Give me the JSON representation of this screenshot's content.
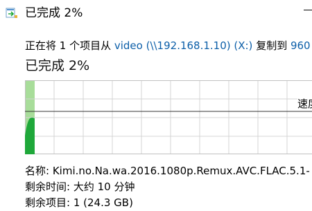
{
  "window": {
    "title": "已完成 2%",
    "minimize_icon": "minimize-icon",
    "app_icon": "copy-progress-icon"
  },
  "operation": {
    "prefix": "正在将 1 个项目从 ",
    "source": "video (\\\\192.168.1.10) (X:)",
    "middle": " 复制到 ",
    "destination": "960"
  },
  "progress": {
    "label": "已完成 2%",
    "percent": 2
  },
  "graph": {
    "speed_label": "速度",
    "colors": {
      "completed_fill": "#a8dd9a",
      "speed_area": "#1fa83a",
      "grid": "#d4d4d4",
      "speed_line": "#333333"
    }
  },
  "details": {
    "name_label": "名称:",
    "name_value": "Kimi.no.Na.wa.2016.1080p.Remux.AVC.FLAC.5.1-",
    "time_label": "剩余时间:",
    "time_value": "大约 10 分钟",
    "items_label": "剩余项目:",
    "items_value": "1 (24.3 GB)"
  }
}
